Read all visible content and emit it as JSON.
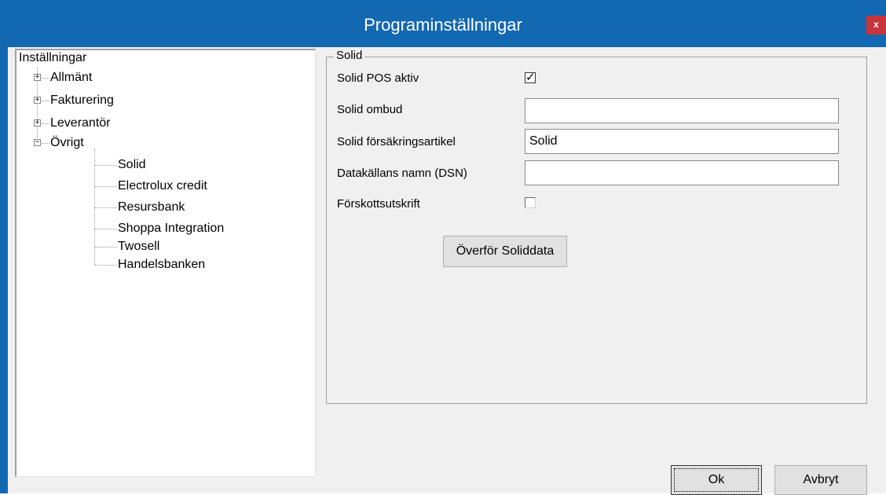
{
  "window": {
    "title": "Programinställningar",
    "close_label": "x"
  },
  "tree": {
    "root": "Inställningar",
    "items": [
      {
        "label": "Allmänt",
        "expander": "+"
      },
      {
        "label": "Fakturering",
        "expander": "+"
      },
      {
        "label": "Leverantör",
        "expander": "+"
      },
      {
        "label": "Övrigt",
        "expander": "−"
      }
    ],
    "children": [
      "Solid",
      "Electrolux credit",
      "Resursbank",
      "Shoppa Integration",
      "Twosell",
      "Handelsbanken"
    ]
  },
  "group": {
    "title": "Solid",
    "pos_aktiv": {
      "label": "Solid POS aktiv",
      "checked": true,
      "mark": "✓"
    },
    "ombud": {
      "label": "Solid ombud",
      "value": ""
    },
    "artikel": {
      "label": "Solid försäkringsartikel",
      "value": "Solid"
    },
    "dsn": {
      "label": "Datakällans namn (DSN)",
      "value": ""
    },
    "forskott": {
      "label": "Förskottsutskrift",
      "checked": false
    },
    "transfer_button": "Överför Soliddata"
  },
  "footer": {
    "ok": "Ok",
    "cancel": "Avbryt"
  }
}
